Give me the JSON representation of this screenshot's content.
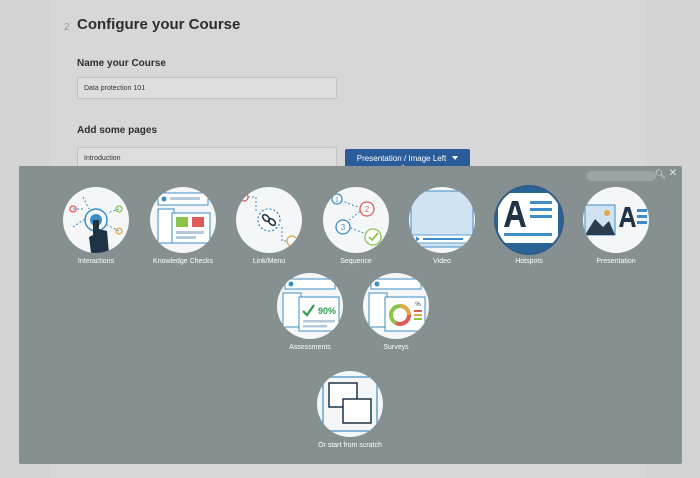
{
  "step": {
    "number": "2",
    "title": "Configure your Course"
  },
  "course_name": {
    "label": "Name your Course",
    "value": "Data protection 101"
  },
  "pages": {
    "label": "Add some pages",
    "first_page_value": "Introduction",
    "layout_button": "Presentation / Image Left"
  },
  "gallery": {
    "search_icon": "magnifier-icon",
    "close_icon": "close-icon",
    "tiles": [
      {
        "label": "Interactions",
        "icon": "interactions-icon"
      },
      {
        "label": "Knowledge Checks",
        "icon": "knowledge-checks-icon"
      },
      {
        "label": "Link/Menu",
        "icon": "link-menu-icon"
      },
      {
        "label": "Sequence",
        "icon": "sequence-icon"
      },
      {
        "label": "Video",
        "icon": "video-icon"
      },
      {
        "label": "Hotspots",
        "icon": "hotspots-icon",
        "selected": true
      },
      {
        "label": "Presentation",
        "icon": "presentation-icon"
      },
      {
        "label": "Assessments",
        "icon": "assessments-icon",
        "badge": "90%"
      },
      {
        "label": "Surveys",
        "icon": "surveys-icon",
        "badge": "%"
      },
      {
        "label": "Or start from scratch",
        "icon": "scratch-icon"
      }
    ]
  },
  "colors": {
    "accent": "#2a5c9a",
    "overlay": "#869090",
    "icon_blue": "#3c8dc8"
  }
}
